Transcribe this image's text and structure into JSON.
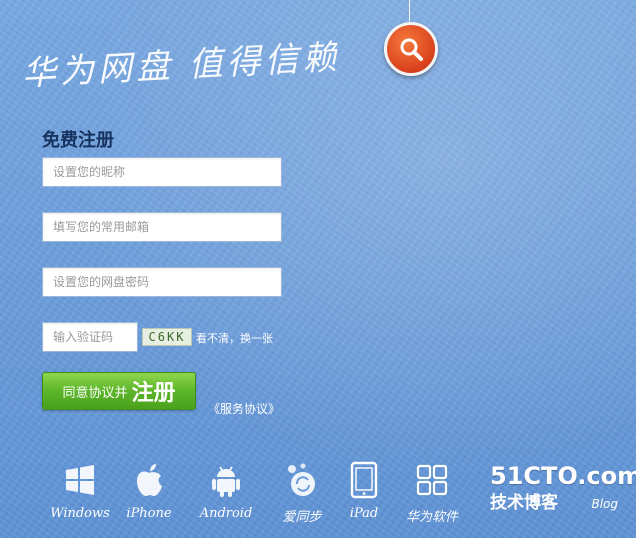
{
  "hero": {
    "slogan": "华为网盘 值得信赖",
    "search_icon": "magnifier-icon"
  },
  "form": {
    "title": "免费注册",
    "nickname_placeholder": "设置您的昵称",
    "email_placeholder": "填写您的常用邮箱",
    "password_placeholder": "设置您的网盘密码",
    "captcha_placeholder": "输入验证码",
    "captcha_code": "C6KK",
    "captcha_refresh": "看不清，换一张",
    "submit_small": "同意协议并",
    "submit_big": "注册",
    "terms_link": "《服务协议》"
  },
  "platforms": [
    {
      "label": "Windows",
      "icon": "windows-icon"
    },
    {
      "label": "iPhone",
      "icon": "apple-icon"
    },
    {
      "label": "Android",
      "icon": "android-icon"
    },
    {
      "label": "爱同步",
      "icon": "sync-icon"
    },
    {
      "label": "iPad",
      "icon": "ipad-icon"
    },
    {
      "label": "华为软件",
      "icon": "apps-grid-icon"
    }
  ],
  "watermark": {
    "site": "51CTO.com",
    "sub": "技术博客",
    "blog": "Blog"
  },
  "colors": {
    "background": "#6b9ddc",
    "register_button": "#5cb529",
    "search_badge": "#d9401c",
    "title": "#17325e"
  }
}
